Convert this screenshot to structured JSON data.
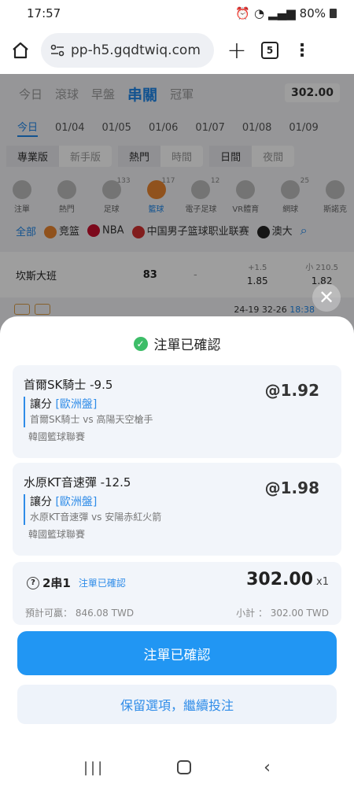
{
  "status": {
    "time": "17:57",
    "battery": "80%"
  },
  "browser": {
    "url": "pp-h5.gqdtwiq.com",
    "tab_count": "5"
  },
  "bg": {
    "tabs": [
      "今日",
      "滾球",
      "早盤",
      "串關",
      "冠軍"
    ],
    "amount": "302.00",
    "dates": [
      "今日",
      "01/04",
      "01/05",
      "01/06",
      "01/07",
      "01/08",
      "01/09"
    ],
    "toggles": {
      "pro": "專業版",
      "newbie": "新手版",
      "hot": "熱門",
      "time": "時間",
      "day": "日間",
      "night": "夜間"
    },
    "sports": [
      {
        "name": "注單",
        "count": ""
      },
      {
        "name": "熱門",
        "count": ""
      },
      {
        "name": "足球",
        "count": "133"
      },
      {
        "name": "籃球",
        "count": "117"
      },
      {
        "name": "電子足球",
        "count": "12"
      },
      {
        "name": "VR體育",
        "count": ""
      },
      {
        "name": "網球",
        "count": "25"
      },
      {
        "name": "斯諾克",
        "count": ""
      }
    ],
    "leagues": {
      "all": "全部",
      "l1": "竞篮",
      "l2": "NBA",
      "l3": "中国男子篮球职业联赛",
      "l4": "澳大"
    },
    "row": {
      "team": "坎斯大班",
      "score": "83",
      "cell": "-",
      "odd1_line": "+1.5",
      "odd1": "1.85",
      "odd2_line": "小 210.5",
      "odd2": "1.82"
    },
    "foot": {
      "score": "24-19 32-26",
      "time": "18:38"
    }
  },
  "sheet": {
    "title": "注單已確認",
    "bets": [
      {
        "pick": "首爾SK騎士 -9.5",
        "odds": "@1.92",
        "market": "讓分",
        "handicap": "[歐洲盤]",
        "match": "首爾SK騎士 vs 高陽天空槍手",
        "league": "韓國籃球聯賽"
      },
      {
        "pick": "水原KT音速彈 -12.5",
        "odds": "@1.98",
        "market": "讓分",
        "handicap": "[歐洲盤]",
        "match": "水原KT音速彈 vs 安陽赤紅火箭",
        "league": "韓國籃球聯賽"
      }
    ],
    "summary": {
      "type": "2串1",
      "status": "注單已確認",
      "amount": "302.00",
      "multiplier": "x1",
      "potential_win": "預計可贏： 846.08 TWD",
      "subtotal": "小計 ： 302.00 TWD"
    },
    "confirm_button": "注單已確認",
    "keep_button": "保留選項，繼續投注"
  },
  "colors": {
    "primary": "#2196f3",
    "link": "#2f8ce8",
    "success": "#3dbd68"
  }
}
